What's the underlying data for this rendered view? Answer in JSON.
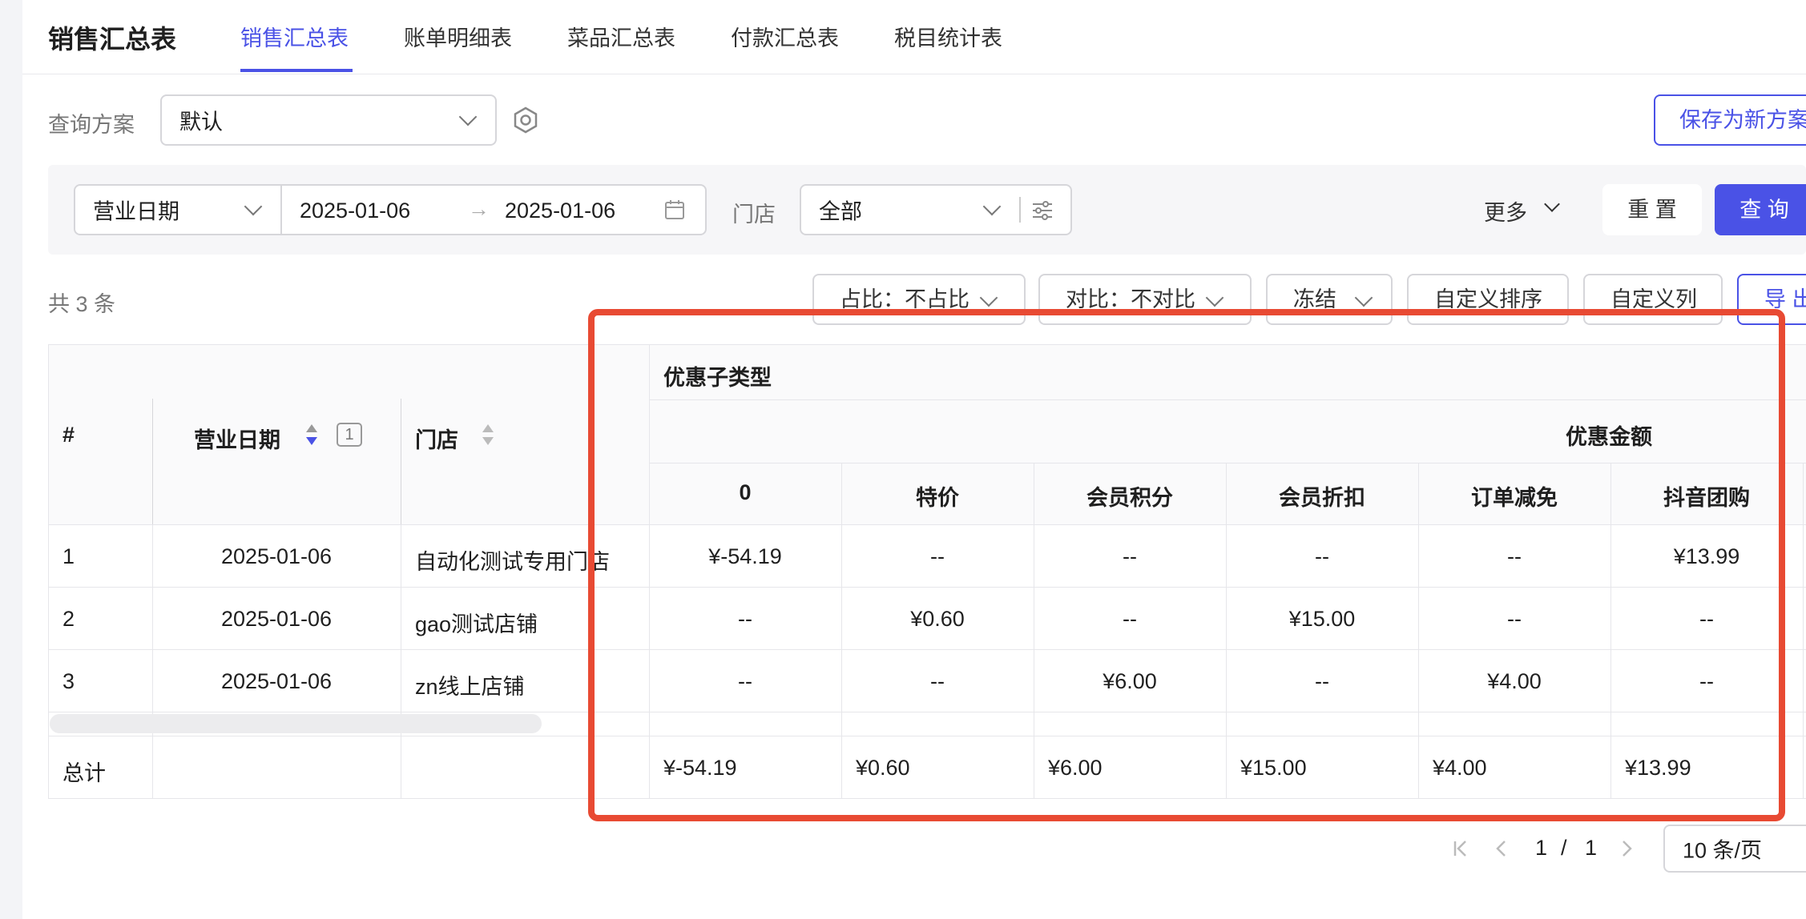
{
  "header": {
    "title": "销售汇总表",
    "tabs": [
      "销售汇总表",
      "账单明细表",
      "菜品汇总表",
      "付款汇总表",
      "税目统计表"
    ]
  },
  "scheme": {
    "label": "查询方案",
    "value": "默认",
    "save_label": "保存为新方案"
  },
  "filters": {
    "date_type": "营业日期",
    "start_date": "2025-01-06",
    "arrow": "→",
    "end_date": "2025-01-06",
    "store_label": "门店",
    "store_value": "全部",
    "more_label": "更多",
    "reset_label": "重 置",
    "query_label": "查 询"
  },
  "toolbar": {
    "count_text": "共 3 条",
    "ratio_label": "占比：不占比",
    "compare_label": "对比：不对比",
    "freeze_label": "冻结",
    "custom_sort_label": "自定义排序",
    "custom_cols_label": "自定义列",
    "export_label": "导 出"
  },
  "table": {
    "headers": {
      "index": "#",
      "date": "营业日期",
      "sort_badge": "1",
      "store": "门店",
      "group": "优惠子类型",
      "subgroup": "优惠金额",
      "cols": [
        "0",
        "特价",
        "会员积分",
        "会员折扣",
        "订单减免",
        "抖音团购"
      ]
    },
    "rows": [
      {
        "index": "1",
        "date": "2025-01-06",
        "store": "自动化测试专用门店",
        "cells": [
          "¥-54.19",
          "--",
          "--",
          "--",
          "--",
          "¥13.99"
        ]
      },
      {
        "index": "2",
        "date": "2025-01-06",
        "store": "gao测试店铺",
        "cells": [
          "--",
          "¥0.60",
          "--",
          "¥15.00",
          "--",
          "--"
        ]
      },
      {
        "index": "3",
        "date": "2025-01-06",
        "store": "zn线上店铺",
        "cells": [
          "--",
          "--",
          "¥6.00",
          "--",
          "¥4.00",
          "--"
        ]
      }
    ],
    "total": {
      "label": "总计",
      "cells": [
        "¥-54.19",
        "¥0.60",
        "¥6.00",
        "¥15.00",
        "¥4.00",
        "¥13.99"
      ]
    }
  },
  "pagination": {
    "current": "1",
    "sep": "/",
    "total": "1",
    "page_size": "10 条/页"
  },
  "colors": {
    "primary": "#4a52e6",
    "highlight": "#e84a33"
  }
}
